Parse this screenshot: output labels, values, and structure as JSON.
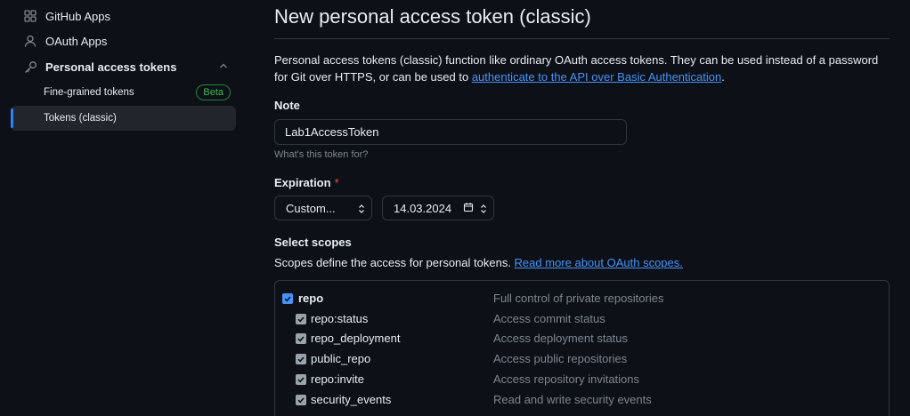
{
  "sidebar": {
    "github_apps": "GitHub Apps",
    "oauth_apps": "OAuth Apps",
    "personal_access_tokens": "Personal access tokens",
    "fine_grained": "Fine-grained tokens",
    "beta_badge": "Beta",
    "tokens_classic": "Tokens (classic)"
  },
  "main": {
    "title": "New personal access token (classic)",
    "desc_part1": "Personal access tokens (classic) function like ordinary OAuth access tokens. They can be used instead of a password for Git over HTTPS, or can be used to ",
    "desc_link": "authenticate to the API over Basic Authentication",
    "desc_end": ".",
    "note_label": "Note",
    "note_value": "Lab1AccessToken",
    "note_hint": "What's this token for?",
    "expiration_label": "Expiration",
    "required_mark": "*",
    "expiration_select": "Custom...",
    "expiration_date": "14.03.2024",
    "scopes_label": "Select scopes",
    "scopes_desc": "Scopes define the access for personal tokens. ",
    "scopes_link": "Read more about OAuth scopes."
  },
  "scopes": [
    {
      "name": "repo",
      "desc": "Full control of private repositories"
    },
    {
      "name": "repo:status",
      "desc": "Access commit status"
    },
    {
      "name": "repo_deployment",
      "desc": "Access deployment status"
    },
    {
      "name": "public_repo",
      "desc": "Access public repositories"
    },
    {
      "name": "repo:invite",
      "desc": "Access repository invitations"
    },
    {
      "name": "security_events",
      "desc": "Read and write security events"
    }
  ],
  "colors": {
    "background": "#0d1117",
    "accent": "#4493f8",
    "beta": "#3fb950",
    "required": "#f85149"
  }
}
